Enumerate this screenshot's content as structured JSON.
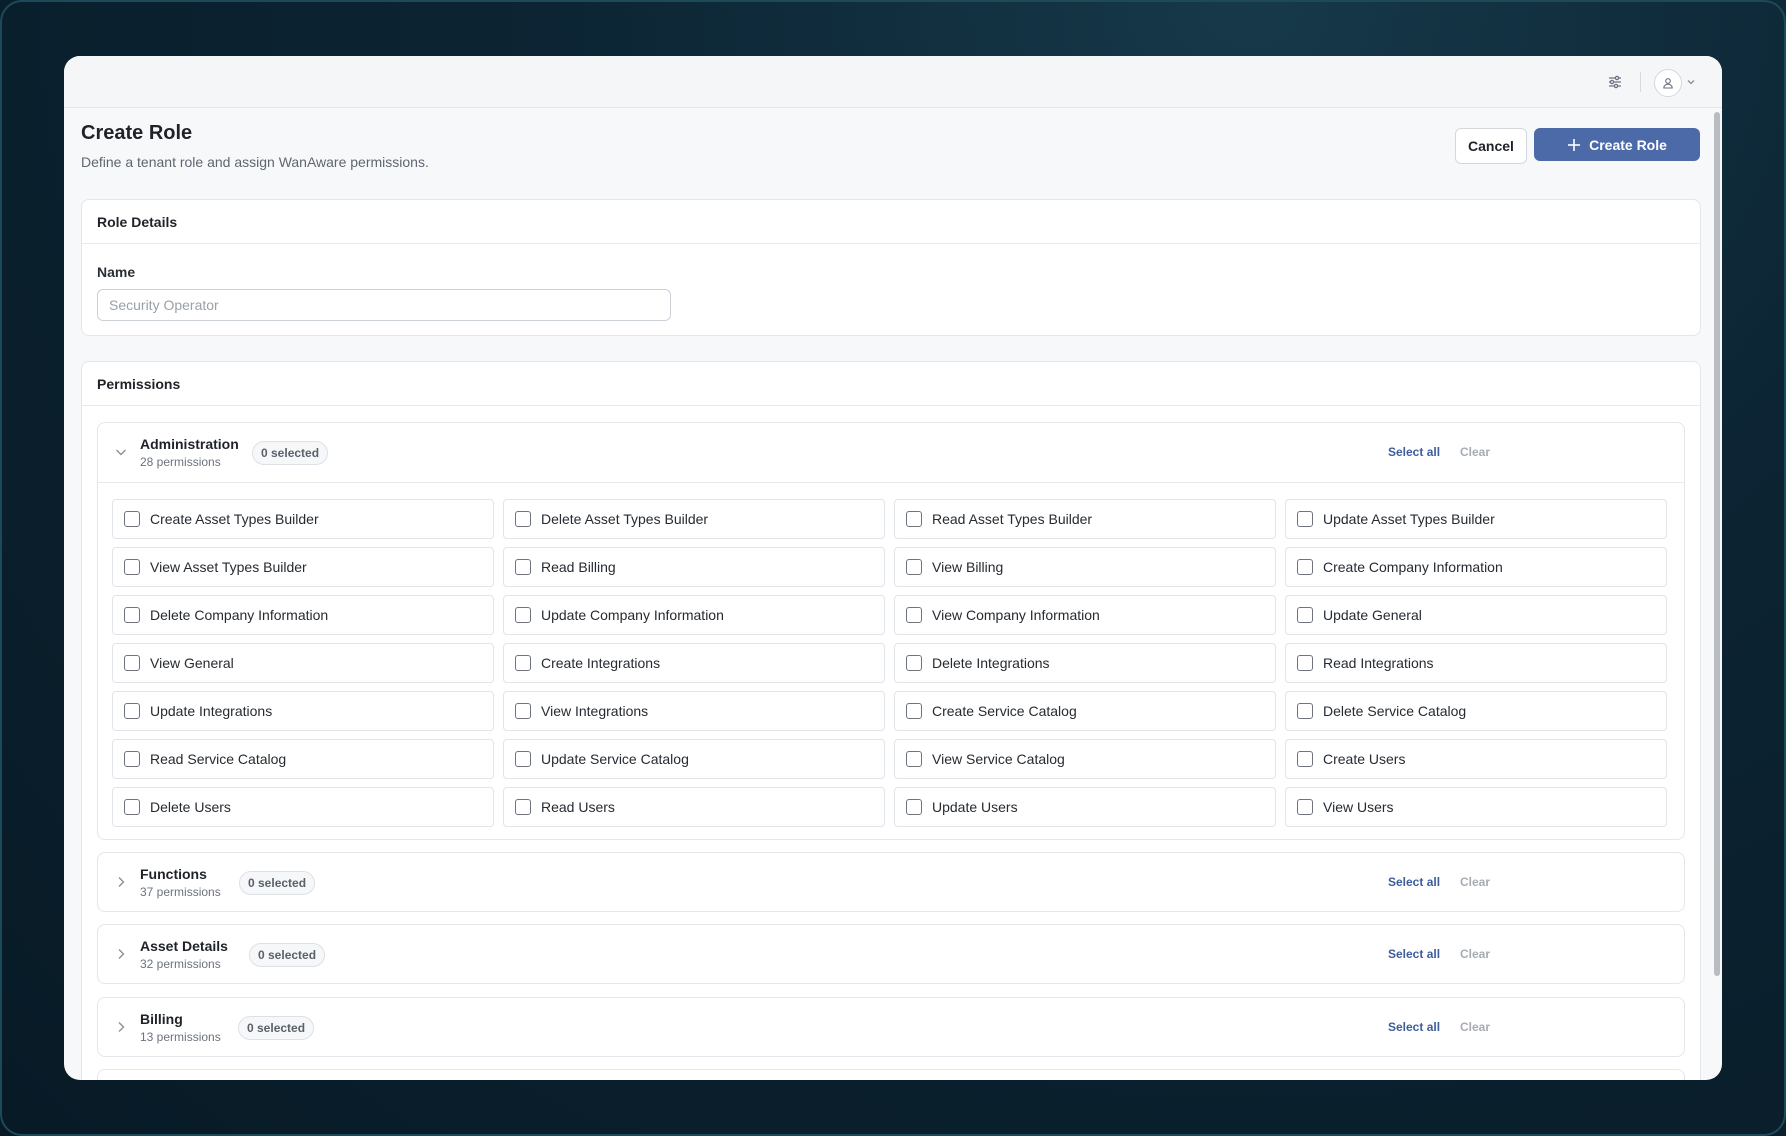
{
  "header": {
    "settings_icon": "sliders-icon",
    "user_icon": "user-icon"
  },
  "page": {
    "title": "Create Role",
    "subtitle": "Define a tenant role and assign WanAware permissions.",
    "cancel_label": "Cancel",
    "create_label": "Create Role"
  },
  "role_details": {
    "heading": "Role Details",
    "name_label": "Name",
    "name_placeholder": "Security Operator",
    "name_value": ""
  },
  "permissions": {
    "heading": "Permissions",
    "select_all_label": "Select all",
    "clear_label": "Clear",
    "groups": [
      {
        "title": "Administration",
        "count": "28 permissions",
        "selected": "0 selected",
        "expanded": true,
        "items": [
          "Create Asset Types Builder",
          "Delete Asset Types Builder",
          "Read Asset Types Builder",
          "Update Asset Types Builder",
          "View Asset Types Builder",
          "Read Billing",
          "View Billing",
          "Create Company Information",
          "Delete Company Information",
          "Update Company Information",
          "View Company Information",
          "Update General",
          "View General",
          "Create Integrations",
          "Delete Integrations",
          "Read Integrations",
          "Update Integrations",
          "View Integrations",
          "Create Service Catalog",
          "Delete Service Catalog",
          "Read Service Catalog",
          "Update Service Catalog",
          "View Service Catalog",
          "Create Users",
          "Delete Users",
          "Read Users",
          "Update Users",
          "View Users"
        ]
      },
      {
        "title": "Functions",
        "count": "37 permissions",
        "selected": "0 selected",
        "expanded": false
      },
      {
        "title": "Asset Details",
        "count": "32 permissions",
        "selected": "0 selected",
        "expanded": false
      },
      {
        "title": "Billing",
        "count": "13 permissions",
        "selected": "0 selected",
        "expanded": false
      }
    ]
  },
  "colors": {
    "primary": "#4c6aa8",
    "link": "#3e5d9b",
    "muted": "#a7acb3"
  }
}
